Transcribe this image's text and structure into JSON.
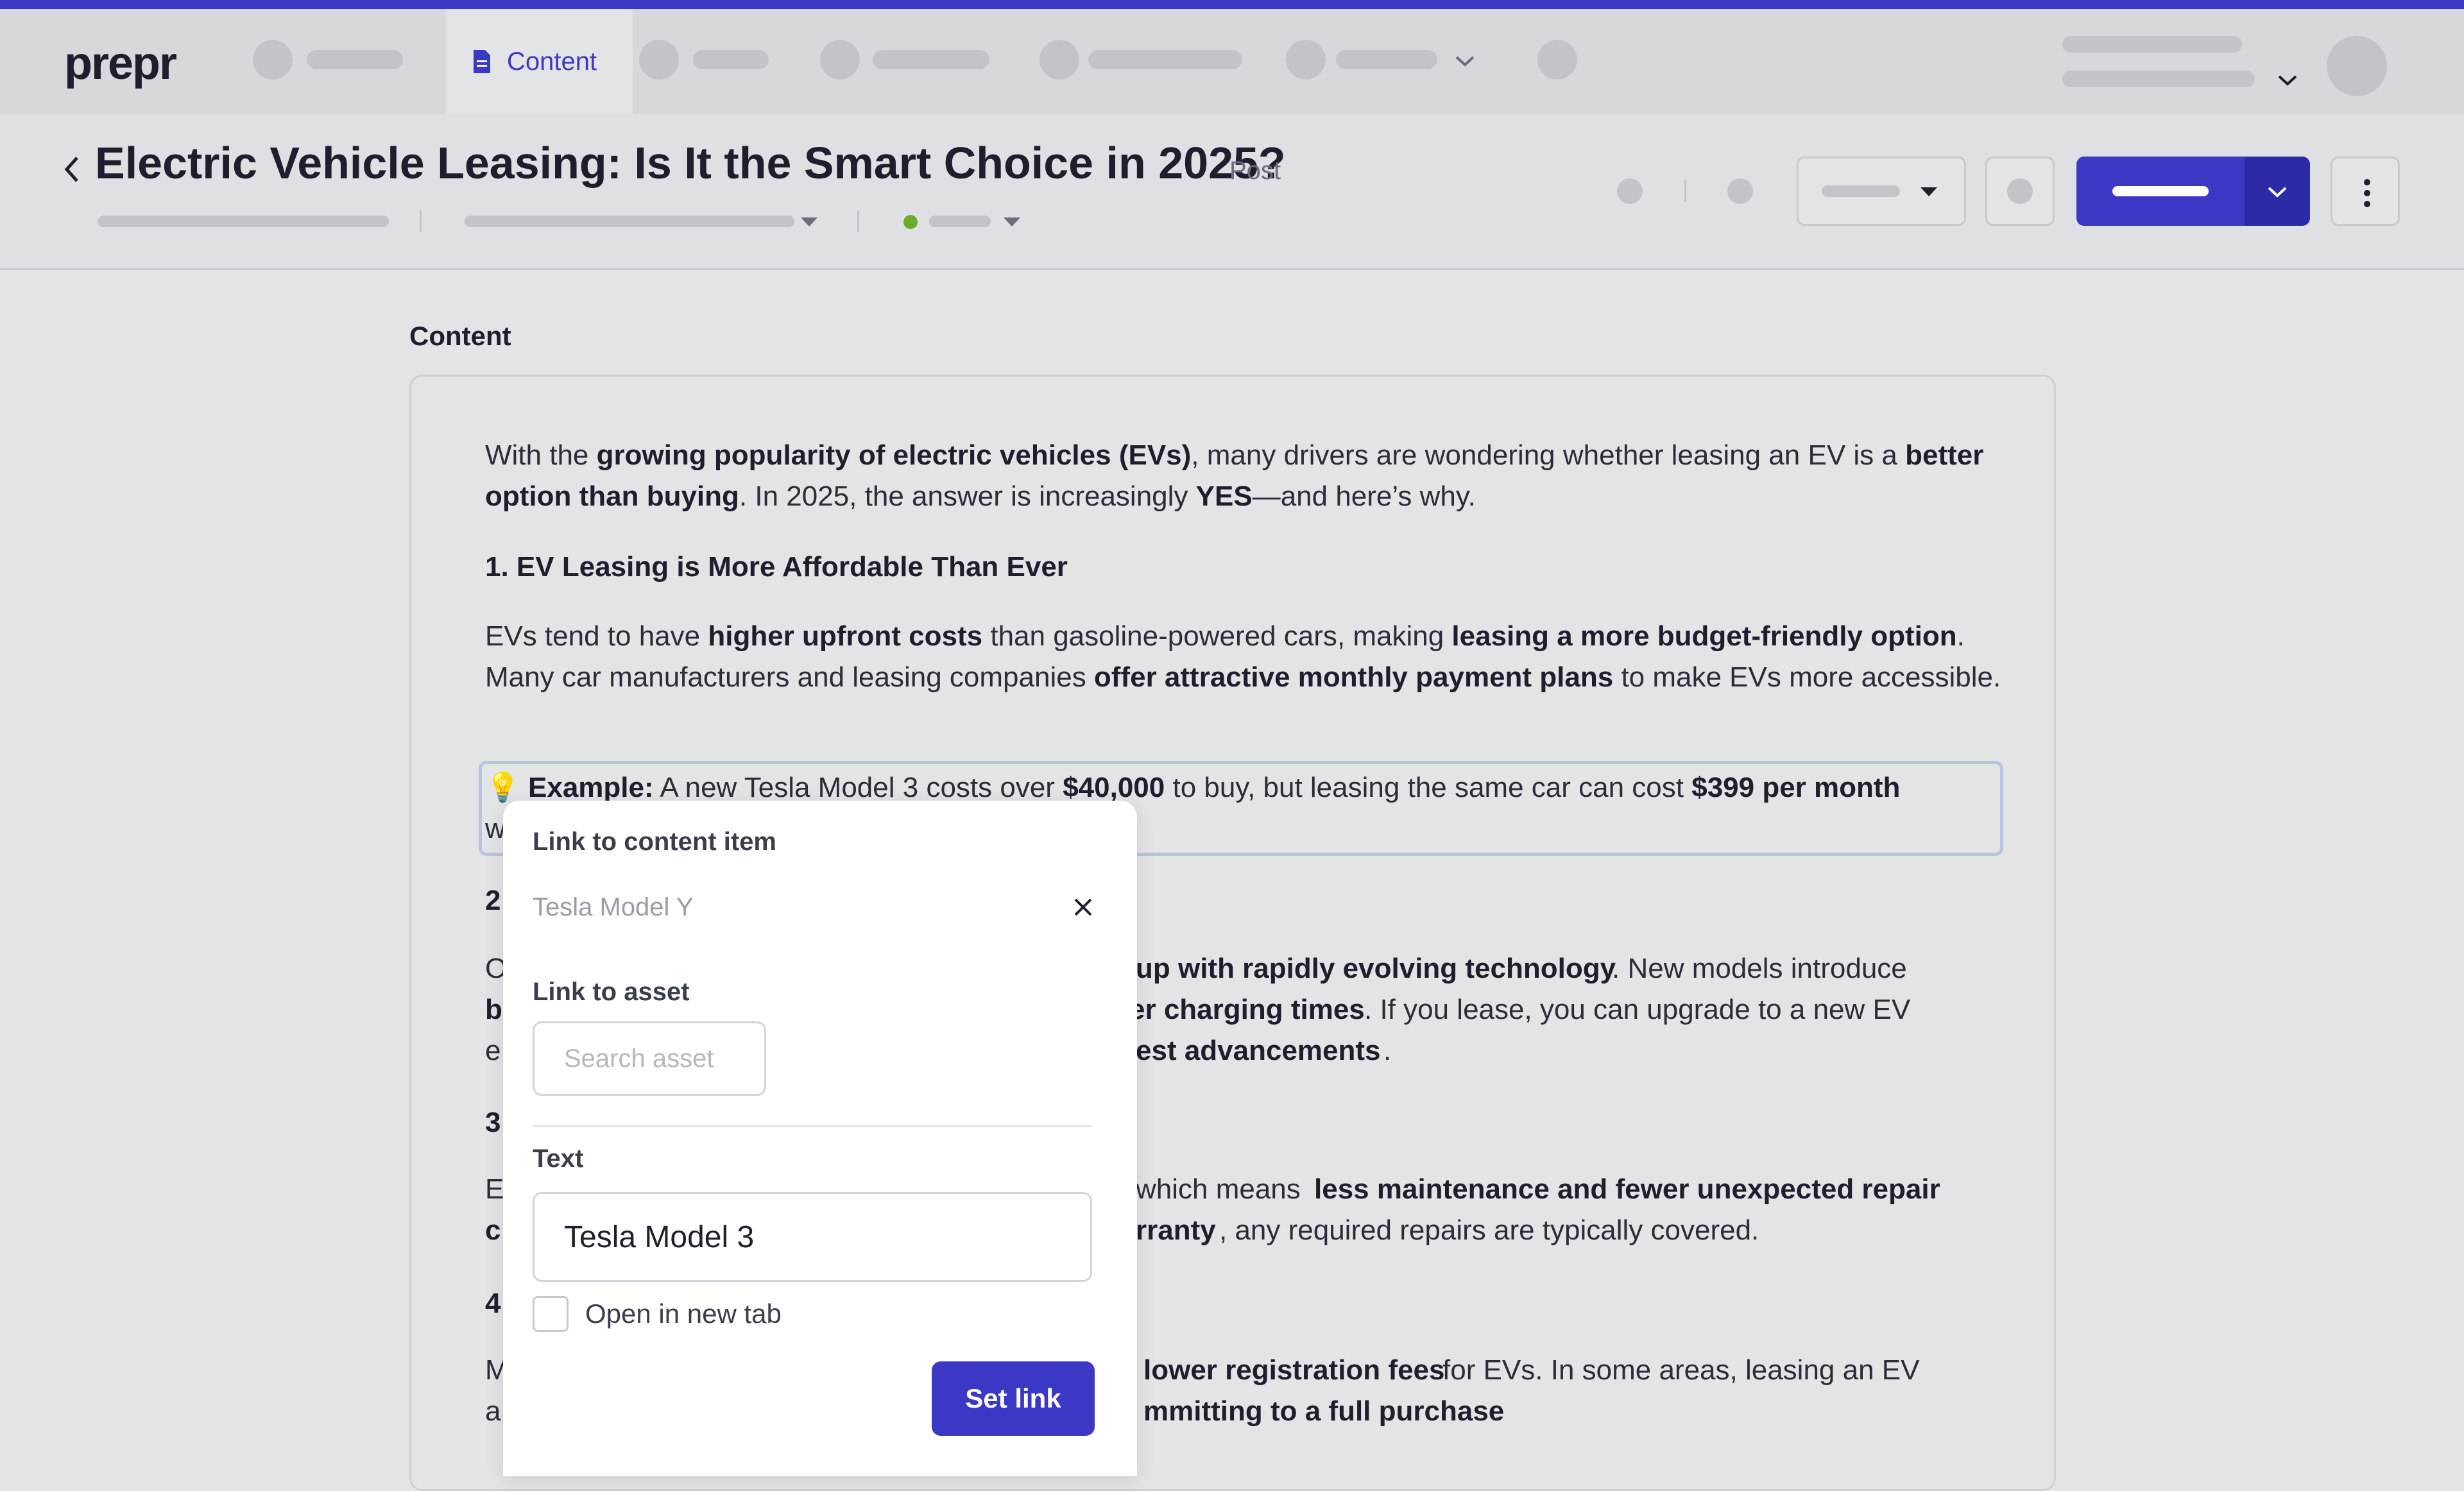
{
  "app": {
    "logo": "prepr"
  },
  "nav": {
    "active_tab": "Content"
  },
  "header": {
    "title": "Electric Vehicle Leasing: Is It the Smart Choice in 2025?",
    "type": "Post"
  },
  "content": {
    "section_label": "Content",
    "paragraphs": [
      {
        "t": "With the "
      },
      {
        "b": "growing popularity of electric vehicles (EVs)"
      },
      {
        "t": ", many drivers are wondering whether leasing an EV is a "
      },
      {
        "b": "better option than buying"
      },
      {
        "t": ". In 2025, the answer is increasingly "
      },
      {
        "b": "YES"
      },
      {
        "t": "—and here’s why."
      }
    ],
    "heading1": "1. EV Leasing is More Affordable Than Ever",
    "para2": [
      {
        "t": "EVs tend to have "
      },
      {
        "b": "higher upfront costs"
      },
      {
        "t": " than gasoline-powered cars, making "
      },
      {
        "b": "leasing a more budget-friendly option"
      },
      {
        "t": ". Many car manufacturers and leasing companies "
      },
      {
        "b": "offer attractive monthly payment plans"
      },
      {
        "t": " to make EVs more accessible."
      }
    ],
    "example1": [
      {
        "t": "💡 "
      },
      {
        "b": "Example:"
      },
      {
        "t": " A new Tesla Model 3 costs over "
      },
      {
        "b": "$40,000"
      },
      {
        "t": " to buy, but leasing the same car can cost "
      },
      {
        "b": "$399 per month"
      }
    ],
    "example1_line2": "w",
    "heading2_visible": "2",
    "para3_visible": [
      {
        "t": "O"
      },
      {
        "b": "up with rapidly evolving technology"
      },
      {
        "t": ". New models introduce"
      }
    ],
    "para3_line2": [
      {
        "b": "b"
      },
      {
        "b": "er charging times"
      },
      {
        "t": ". If you lease, you can upgrade to a new EV"
      }
    ],
    "para3_line3": [
      {
        "t": "e"
      },
      {
        "b": "est advancements"
      },
      {
        "t": "."
      }
    ],
    "heading3_visible": "3",
    "para4_line1": [
      {
        "t": "E"
      },
      {
        "t": "which means "
      },
      {
        "b": "less maintenance and fewer unexpected repair"
      }
    ],
    "para4_line2": [
      {
        "b": "c"
      },
      {
        "b": "rranty"
      },
      {
        "t": ", any required repairs are typically covered."
      }
    ],
    "heading4_visible": "4",
    "para5_line1": [
      {
        "t": "M"
      },
      {
        "b": "lower registration fees"
      },
      {
        "t": " for EVs. In some areas, leasing an EV"
      }
    ],
    "para5_line2": [
      {
        "t": "a"
      },
      {
        "b": "mmitting to a full purchase"
      },
      {
        "t": "."
      }
    ]
  },
  "link_popup": {
    "content_item_label": "Link to content item",
    "content_item_value": "Tesla Model Y",
    "asset_label": "Link to asset",
    "asset_placeholder": "Search asset",
    "text_label": "Text",
    "text_value": "Tesla Model 3",
    "new_tab_label": "Open in new tab",
    "set_link_label": "Set link"
  },
  "colors": {
    "accent": "#3c38c6",
    "status_green": "#6aad2e"
  }
}
